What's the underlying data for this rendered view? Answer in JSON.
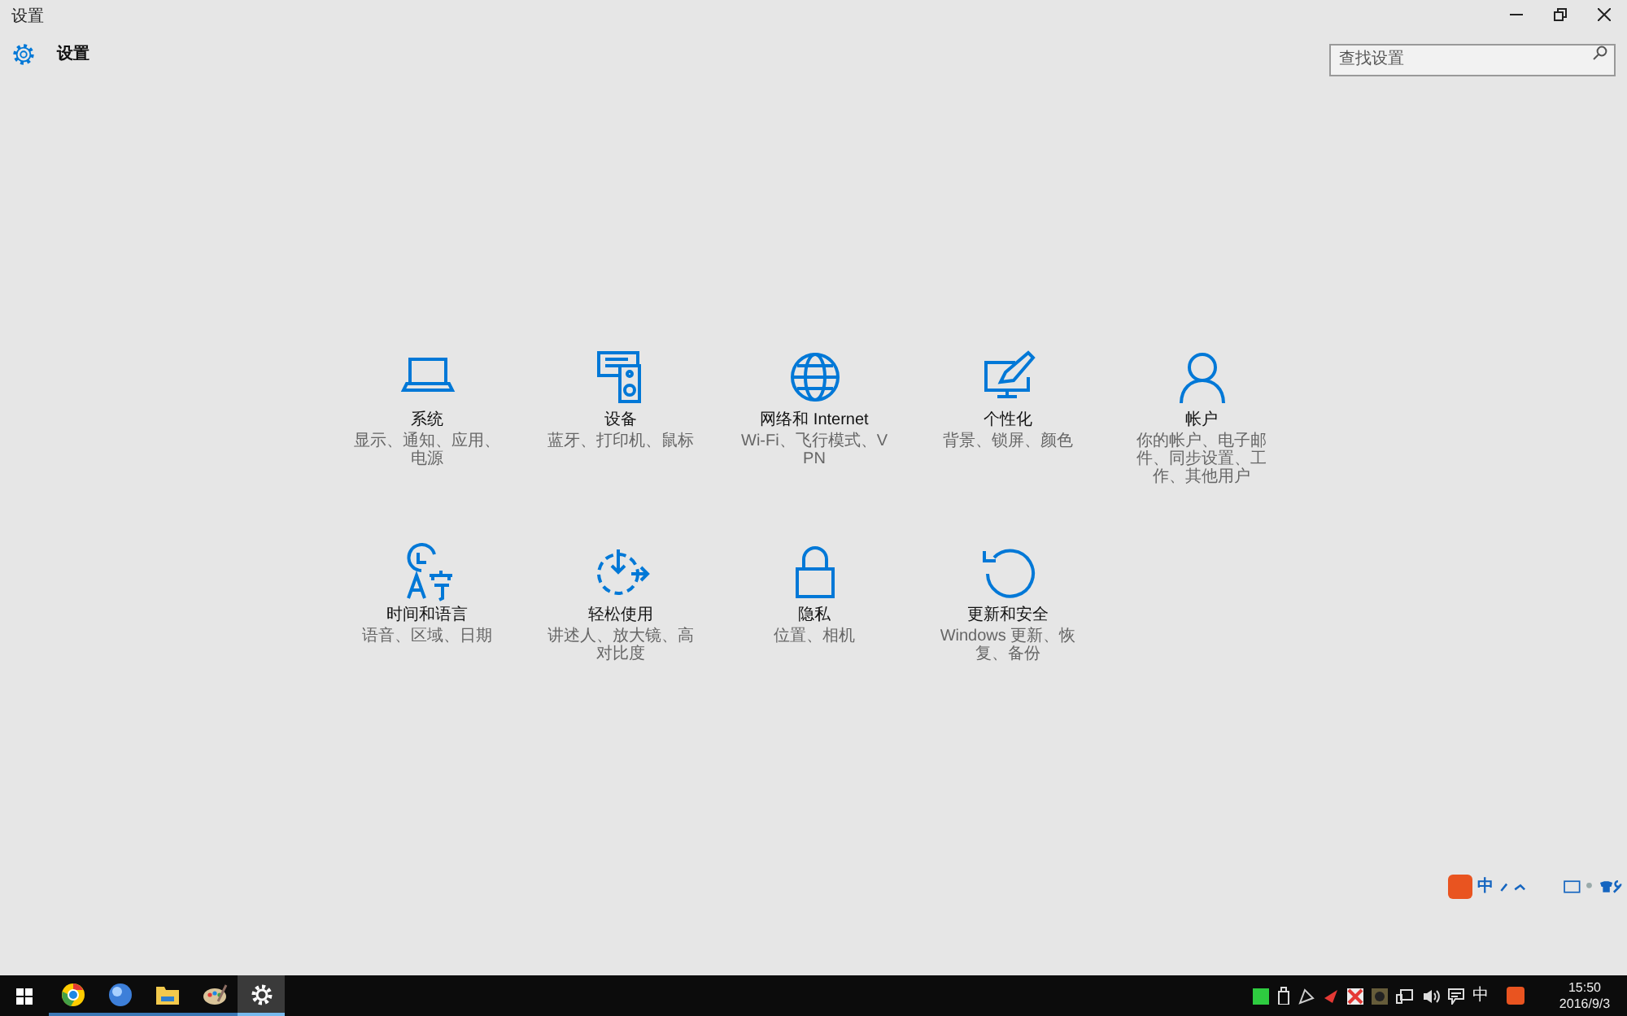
{
  "window": {
    "title": "设置",
    "header": "设置"
  },
  "search": {
    "placeholder": "查找设置"
  },
  "categories": [
    {
      "kind": "laptop",
      "title": "系统",
      "desc": "显示、通知、应用、电源"
    },
    {
      "kind": "devices",
      "title": "设备",
      "desc": "蓝牙、打印机、鼠标"
    },
    {
      "kind": "globe",
      "title": "网络和 Internet",
      "desc": "Wi-Fi、飞行模式、VPN"
    },
    {
      "kind": "paint",
      "title": "个性化",
      "desc": "背景、锁屏、颜色"
    },
    {
      "kind": "person",
      "title": "帐户",
      "desc": "你的帐户、电子邮件、同步设置、工作、其他用户"
    },
    {
      "kind": "time",
      "title": "时间和语言",
      "desc": "语音、区域、日期"
    },
    {
      "kind": "ease",
      "title": "轻松使用",
      "desc": "讲述人、放大镜、高对比度"
    },
    {
      "kind": "lock",
      "title": "隐私",
      "desc": "位置、相机"
    },
    {
      "kind": "update",
      "title": "更新和安全",
      "desc": "Windows 更新、恢复、备份"
    }
  ],
  "ime_bar": {
    "mode": "中"
  },
  "taskbar": {
    "apps": [
      {
        "kind": "browser",
        "selected": false
      },
      {
        "kind": "globe",
        "selected": false
      },
      {
        "kind": "folder",
        "selected": false
      },
      {
        "kind": "paint",
        "selected": false
      },
      {
        "kind": "gear",
        "selected": true
      }
    ],
    "ime": "中",
    "time": "15:50",
    "date": "2016/9/3"
  }
}
